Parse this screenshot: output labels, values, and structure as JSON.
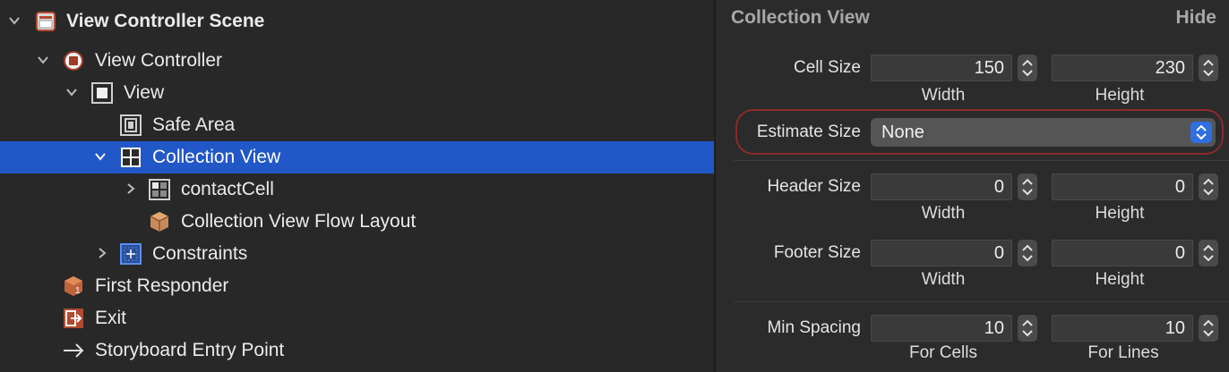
{
  "outline": {
    "scene": "View Controller Scene",
    "view_controller": "View Controller",
    "view": "View",
    "safe_area": "Safe Area",
    "collection_view": "Collection View",
    "contact_cell": "contactCell",
    "flow_layout": "Collection View Flow Layout",
    "constraints": "Constraints",
    "first_responder": "First Responder",
    "exit": "Exit",
    "entry_point": "Storyboard Entry Point",
    "selected_item": "Collection View"
  },
  "inspector": {
    "title": "Collection View",
    "hide": "Hide",
    "cell_size": {
      "label": "Cell Size",
      "width": "150",
      "height": "230",
      "width_label": "Width",
      "height_label": "Height"
    },
    "estimate_size": {
      "label": "Estimate Size",
      "value": "None"
    },
    "header_size": {
      "label": "Header Size",
      "width": "0",
      "height": "0",
      "width_label": "Width",
      "height_label": "Height"
    },
    "footer_size": {
      "label": "Footer Size",
      "width": "0",
      "height": "0",
      "width_label": "Width",
      "height_label": "Height"
    },
    "min_spacing": {
      "label": "Min Spacing",
      "cells": "10",
      "lines": "10",
      "cells_label": "For Cells",
      "lines_label": "For Lines"
    }
  },
  "colors": {
    "selection": "#2257c7",
    "highlight_ring": "#8c2a2a",
    "popup_accent": "#2f6fe0"
  }
}
